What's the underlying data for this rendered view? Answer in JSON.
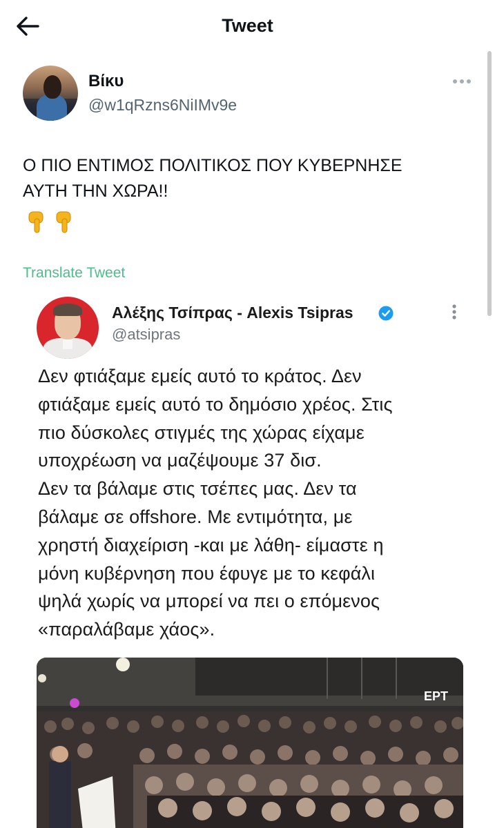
{
  "header": {
    "title": "Tweet"
  },
  "tweet": {
    "author_name": "Βίκυ",
    "author_handle": "@w1qRzns6NiIMv9e",
    "text_lines": [
      "Ο ΠΙΟ ΕΝΤΙΜΟΣ ΠΟΛΙΤΙΚΟΣ ΠΟΥ ΚΥΒΕΡΝΗΣΕ",
      "ΑΥΤΗ ΤΗΝ ΧΩΡΑ!!"
    ],
    "translate_label": "Translate Tweet"
  },
  "quoted": {
    "name": "Αλέξης Τσίπρας - Alexis Tsipras",
    "handle": "@atsipras",
    "text_lines": [
      "Δεν φτιάξαμε εμείς αυτό το κράτος. Δεν",
      "φτιάξαμε εμείς αυτό το δημόσιο χρέος. Στις",
      "πιο δύσκολες στιγμές της χώρας είχαμε",
      "υποχρέωση να μαζέψουμε 37 δισ.",
      "Δεν τα βάλαμε στις τσέπες μας. Δεν τα",
      "βάλαμε σε offshore. Με εντιμότητα, με",
      "χρηστή διαχείριση -και με λάθη- είμαστε η",
      "μόνη κυβέρνηση που έφυγε με το κεφάλι",
      "ψηλά χωρίς να μπορεί να πει ο επόμενος",
      "«παραλάβαμε χάος»."
    ],
    "image_watermark": "ΕΡΤ"
  },
  "colors": {
    "translate": "#4bbf8a",
    "verified": "#1d9bf0",
    "handle": "#536471"
  },
  "icons": [
    "back-arrow-icon",
    "more-options-icon",
    "pointing-down-emoji-icon",
    "verified-badge-icon"
  ]
}
